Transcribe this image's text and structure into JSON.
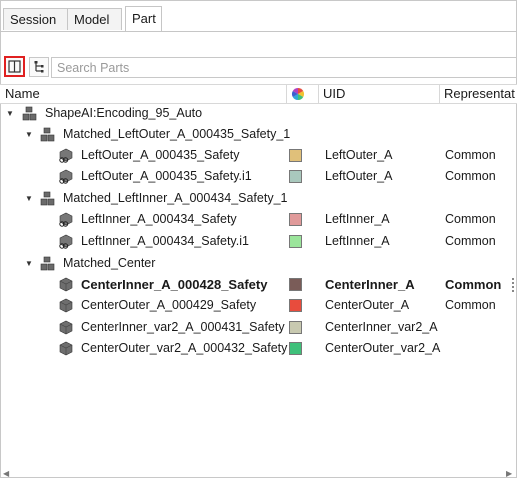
{
  "tabs": [
    {
      "label": "Session"
    },
    {
      "label": "Model"
    },
    {
      "label": "Part"
    }
  ],
  "toolbar": {
    "search_placeholder": "Search Parts"
  },
  "columns": {
    "name": "Name",
    "uid": "UID",
    "representation": "Representat"
  },
  "rows": [
    {
      "name": "ShapeAI:Encoding_95_Auto",
      "kind": "assembly",
      "expanded": true
    },
    {
      "name": "Matched_LeftOuter_A_000435_Safety_1",
      "kind": "assembly",
      "expanded": true
    },
    {
      "name": "LeftOuter_A_000435_Safety",
      "kind": "part-linked",
      "color": "#e0c07a",
      "uid": "LeftOuter_A",
      "rep": "Common"
    },
    {
      "name": "LeftOuter_A_000435_Safety.i1",
      "kind": "part-linked",
      "color": "#a9c8bd",
      "uid": "LeftOuter_A",
      "rep": "Common"
    },
    {
      "name": "Matched_LeftInner_A_000434_Safety_1",
      "kind": "assembly",
      "expanded": true
    },
    {
      "name": "LeftInner_A_000434_Safety",
      "kind": "part-linked",
      "color": "#e09a9a",
      "uid": "LeftInner_A",
      "rep": "Common"
    },
    {
      "name": "LeftInner_A_000434_Safety.i1",
      "kind": "part-linked",
      "color": "#9be59b",
      "uid": "LeftInner_A",
      "rep": "Common"
    },
    {
      "name": "Matched_Center",
      "kind": "assembly",
      "expanded": true
    },
    {
      "name": "CenterInner_A_000428_Safety",
      "kind": "part",
      "color": "#7a5c58",
      "uid": "CenterInner_A",
      "rep": "Common"
    },
    {
      "name": "CenterOuter_A_000429_Safety",
      "kind": "part",
      "color": "#e84c3d",
      "uid": "CenterOuter_A",
      "rep": "Common"
    },
    {
      "name": "CenterInner_var2_A_000431_Safety",
      "kind": "part",
      "color": "#c8c9b0",
      "uid": "CenterInner_var2_A",
      "rep": ""
    },
    {
      "name": "CenterOuter_var2_A_000432_Safety",
      "kind": "part",
      "color": "#3fc07a",
      "uid": "CenterOuter_var2_A",
      "rep": ""
    }
  ]
}
